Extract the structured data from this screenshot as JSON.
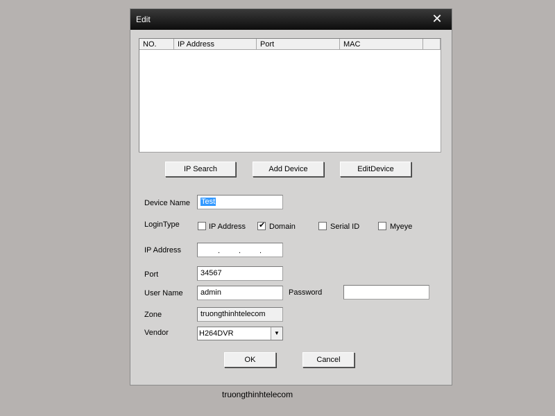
{
  "window": {
    "title": "Edit",
    "close_glyph": "✕"
  },
  "device_list": {
    "columns": [
      "NO.",
      "IP Address",
      "Port",
      "MAC"
    ]
  },
  "actions": {
    "ip_search": "IP Search",
    "add_device": "Add Device",
    "edit_device": "EditDevice"
  },
  "form": {
    "device_name_label": "Device Name",
    "device_name_value": "Test",
    "login_type_label": "LoginType",
    "login_types": [
      {
        "label": "IP Address",
        "checked": false
      },
      {
        "label": "Domain",
        "checked": true
      },
      {
        "label": "Serial ID",
        "checked": false
      },
      {
        "label": "Myeye",
        "checked": false
      }
    ],
    "check_glyph": "✔",
    "ip_address_label": "IP Address",
    "ip_dot": ".",
    "port_label": "Port",
    "port_value": "34567",
    "user_name_label": "User Name",
    "user_name_value": "admin",
    "password_label": "Password",
    "password_value": "",
    "zone_label": "Zone",
    "zone_value": "truongthinhtelecom",
    "vendor_label": "Vendor",
    "vendor_value": "H264DVR",
    "dropdown_glyph": "▼"
  },
  "footer": {
    "ok": "OK",
    "cancel": "Cancel"
  },
  "watermark": "truongthinhtelecom"
}
